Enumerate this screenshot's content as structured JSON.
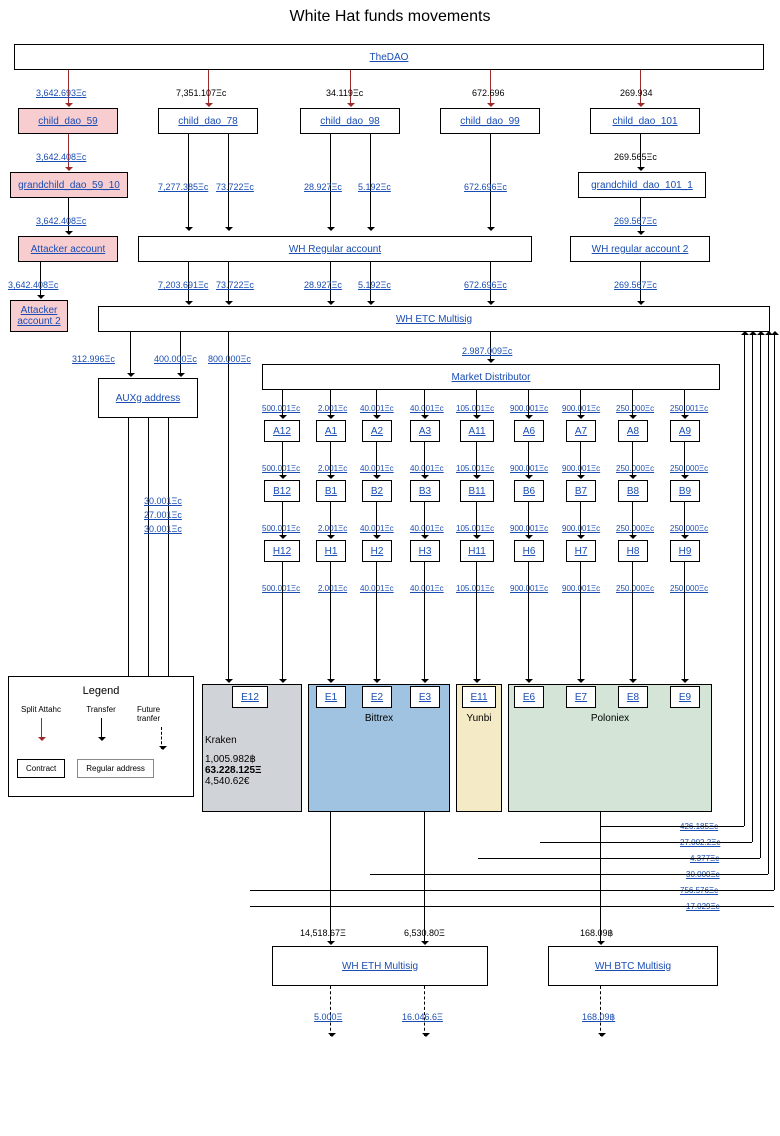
{
  "title": "White Hat funds movements",
  "nodes": {
    "thedao": "TheDAO",
    "cd59": "child_dao_59",
    "cd78": "child_dao_78",
    "cd98": "child_dao_98",
    "cd99": "child_dao_99",
    "cd101": "child_dao_101",
    "gc59": "grandchild_dao_59_10",
    "gc101": "grandchild_dao_101_1",
    "attacker": "Attacker account",
    "attacker2": "Attacker account 2",
    "whreg": "WH Regular account",
    "whreg2": "WH regular account 2",
    "whetc": "WH ETC Multisig",
    "auxg": "AUXg address",
    "market": "Market Distributor",
    "a12": "A12",
    "a1": "A1",
    "a2": "A2",
    "a3": "A3",
    "a11": "A11",
    "a6": "A6",
    "a7": "A7",
    "a8": "A8",
    "a9": "A9",
    "b12": "B12",
    "b1": "B1",
    "b2": "B2",
    "b3": "B3",
    "b11": "B11",
    "b6": "B6",
    "b7": "B7",
    "b8": "B8",
    "b9": "B9",
    "h12": "H12",
    "h1": "H1",
    "h2": "H2",
    "h3": "H3",
    "h11": "H11",
    "h6": "H6",
    "h7": "H7",
    "h8": "H8",
    "h9": "H9",
    "e12": "E12",
    "e1": "E1",
    "e2": "E2",
    "e3": "E3",
    "e11": "E11",
    "e6": "E6",
    "e7": "E7",
    "e8": "E8",
    "e9": "E9",
    "kraken": "Kraken",
    "bittrex": "Bittrex",
    "yunbi": "Yunbi",
    "poloniex": "Poloniex",
    "wh_eth": "WH ETH Multisig",
    "wh_btc": "WH BTC Multisig"
  },
  "kraken_vals": {
    "btc": "1,005.982฿",
    "eth": "63.228.125Ξ",
    "eur": "4,540.62€"
  },
  "amounts": {
    "t59": "3,642.693Ξc",
    "t78": "7,351.107Ξc",
    "t98": "34.119Ξc",
    "t99": "672.696",
    "t101": "269.934",
    "c59g": "3,642.408Ξc",
    "c101g": "269.565Ξc",
    "g59a": "3,642.408Ξc",
    "g101a": "269.567Ξc",
    "a2a": "3,642.408Ξc",
    "c78w1": "7,277.385Ξc",
    "c78w2": "73.722Ξc",
    "c98w1": "28.927Ξc",
    "c98w2": "5.192Ξc",
    "c99w": "672.696Ξc",
    "whr_etc1": "7,203.691Ξc",
    "whr_etc2": "73.722Ξc",
    "whr_etc3": "28.927Ξc",
    "whr_etc4": "5.192Ξc",
    "whr_etc5": "672.696Ξc",
    "whr2_etc": "269.567Ξc",
    "aux312": "312.996Ξc",
    "aux400": "400.000Ξc",
    "aux800": "800.000Ξc",
    "aux30a": "30.001Ξc",
    "aux27": "27.001Ξc",
    "aux30b": "30.001Ξc",
    "m_total": "2.987.009Ξc",
    "m1": "500.001Ξc",
    "m2": "2.001Ξc",
    "m3": "40.001Ξc",
    "m4": "40.001Ξc",
    "m5": "105.001Ξc",
    "m6": "900.001Ξc",
    "m7": "900.001Ξc",
    "m8": "250.000Ξc",
    "m9": "250.001Ξc",
    "ab1": "500.001Ξc",
    "ab2": "2.001Ξc",
    "ab3": "40.001Ξc",
    "ab4": "40.001Ξc",
    "ab5": "105.001Ξc",
    "ab6": "900.001Ξc",
    "ab7": "900.001Ξc",
    "ab8": "250.000Ξc",
    "ab9": "250.000Ξc",
    "bh1": "500.001Ξc",
    "bh2": "2.001Ξc",
    "bh3": "40.001Ξc",
    "bh4": "40.001Ξc",
    "bh5": "105.001Ξc",
    "bh6": "900.001Ξc",
    "bh7": "900.001Ξc",
    "bh8": "250.000Ξc",
    "bh9": "250.000Ξc",
    "he1": "500.001Ξc",
    "he2": "2.001Ξc",
    "he3": "40.001Ξc",
    "he4": "40.001Ξc",
    "he5": "105.001Ξc",
    "he6": "900.001Ξc",
    "he7": "900.001Ξc",
    "he8": "250.000Ξc",
    "he9": "250.000Ξc",
    "wh_eth1": "14,518.67Ξ",
    "wh_eth2": "6,530.80Ξ",
    "wh_btc1": "168.09฿",
    "ret1": "5.000Ξ",
    "ret2": "16.046.6Ξ",
    "ret3": "168.09฿",
    "p1": "426.185Ξc",
    "p2": "27.002.2Ξc",
    "p3": "4.377Ξc",
    "p4": "30.000Ξc",
    "p5": "756.576Ξc",
    "p6": "17.029Ξc"
  },
  "legend": {
    "title": "Legend",
    "split": "Split Attahc",
    "transfer": "Transfer",
    "future": "Future tranfer",
    "contract": "Contract",
    "regular": "Regular address"
  }
}
